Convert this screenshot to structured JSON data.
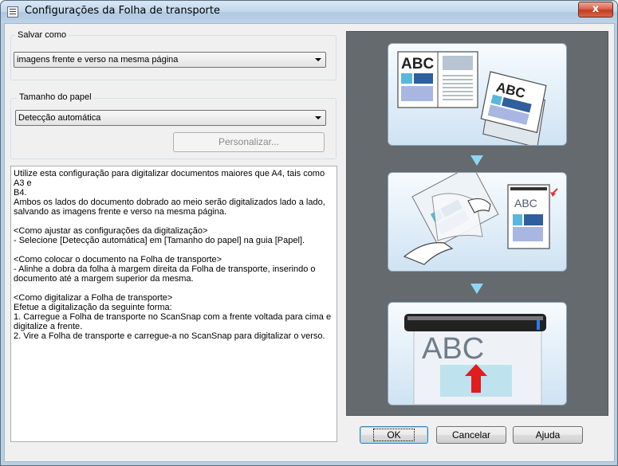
{
  "window": {
    "title": "Configurações da Folha de transporte",
    "close_label": "x"
  },
  "save_as": {
    "group_label": "Salvar como",
    "selected": "imagens frente e verso na mesma página"
  },
  "paper_size": {
    "group_label": "Tamanho do papel",
    "selected": "Detecção automática",
    "customize_label": "Personalizar..."
  },
  "description": {
    "lines": [
      "Utilize esta configuração para digitalizar documentos maiores que A4, tais como A3 e",
      "B4.",
      "Ambos os lados do documento dobrado ao meio serão digitalizados lado a lado,",
      "salvando as imagens frente e verso na mesma página.",
      "",
      "<Como ajustar as configurações da digitalização>",
      "- Selecione [Detecção automática] em [Tamanho do papel] na guia [Papel].",
      "",
      "<Como colocar o documento na Folha de transporte>",
      "- Alinhe a dobra da folha à margem direita da Folha de transporte, inserindo o",
      "documento até a margem superior da mesma.",
      "",
      "<Como digitalizar a Folha de transporte>",
      "Efetue a digitalização da seguinte forma:",
      "1. Carregue a Folha de transporte no ScanSnap com a frente voltada para cima e",
      "digitalize a frente.",
      "2. Vire a Folha de transporte e carregue-a no ScanSnap para digitalizar o verso."
    ]
  },
  "illustration": {
    "page_text": "ABC",
    "arrow_color": "#8fd6f4"
  },
  "buttons": {
    "ok": "OK",
    "cancel": "Cancelar",
    "help": "Ajuda"
  }
}
